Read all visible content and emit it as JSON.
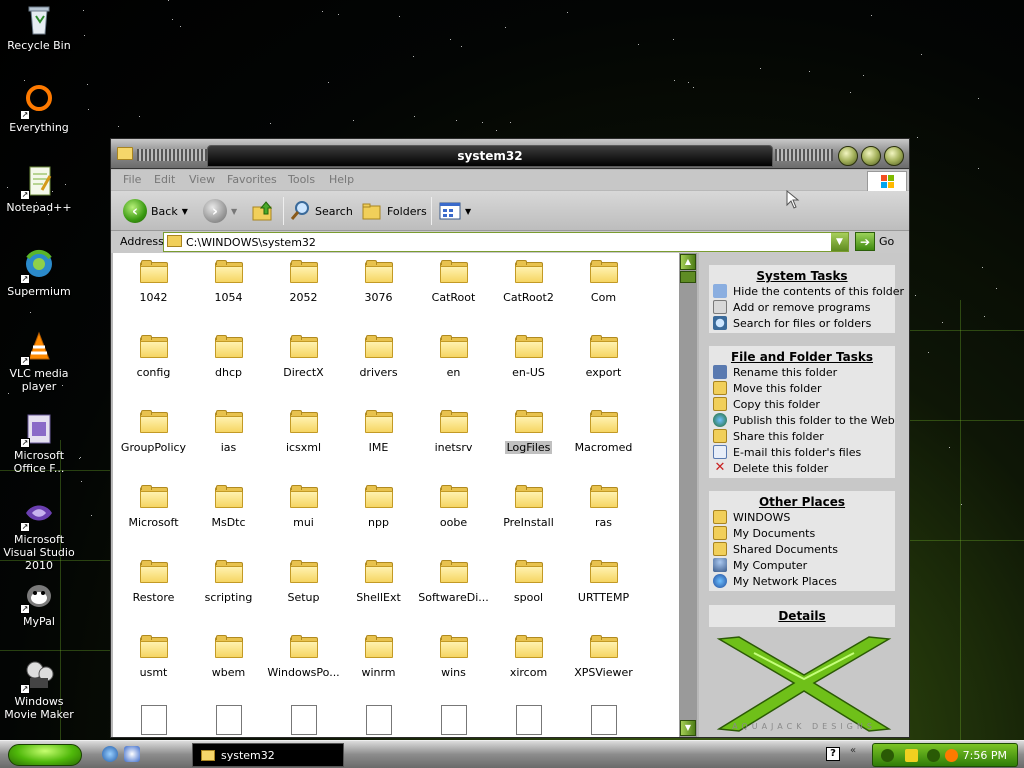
{
  "desktop": {
    "icons": [
      {
        "name": "recycle-bin",
        "label": "Recycle Bin"
      },
      {
        "name": "everything",
        "label": "Everything"
      },
      {
        "name": "notepadpp",
        "label": "Notepad++"
      },
      {
        "name": "supermium",
        "label": "Supermium"
      },
      {
        "name": "vlc",
        "label": "VLC media player"
      },
      {
        "name": "ms-office",
        "label": "Microsoft Office F..."
      },
      {
        "name": "ms-visual-studio",
        "label": "Microsoft Visual Studio 2010"
      },
      {
        "name": "mypal",
        "label": "MyPal"
      },
      {
        "name": "windows-movie-maker",
        "label": "Windows Movie Maker"
      }
    ]
  },
  "window": {
    "title": "system32",
    "menu": [
      "File",
      "Edit",
      "View",
      "Favorites",
      "Tools",
      "Help"
    ],
    "toolbar": {
      "back_label": "Back",
      "search_label": "Search",
      "folders_label": "Folders"
    },
    "address": {
      "label": "Address",
      "value": "C:\\WINDOWS\\system32",
      "go_label": "Go"
    },
    "items": [
      "1042",
      "1054",
      "2052",
      "3076",
      "CatRoot",
      "CatRoot2",
      "Com",
      "config",
      "dhcp",
      "DirectX",
      "drivers",
      "en",
      "en-US",
      "export",
      "GroupPolicy",
      "ias",
      "icsxml",
      "IME",
      "inetsrv",
      "LogFiles",
      "Macromed",
      "Microsoft",
      "MsDtc",
      "mui",
      "npp",
      "oobe",
      "PreInstall",
      "ras",
      "Restore",
      "scripting",
      "Setup",
      "ShellExt",
      "SoftwareDi...",
      "spool",
      "URTTEMP",
      "usmt",
      "wbem",
      "WindowsPo...",
      "winrm",
      "wins",
      "xircom",
      "XPSViewer"
    ],
    "selected_item": "LogFiles",
    "side_pane": {
      "system_tasks": {
        "title": "System Tasks",
        "items": [
          "Hide the contents of this folder",
          "Add or remove programs",
          "Search for files or folders"
        ]
      },
      "file_tasks": {
        "title": "File and Folder Tasks",
        "items": [
          "Rename this folder",
          "Move this folder",
          "Copy this folder",
          "Publish this folder to the Web",
          "Share this folder",
          "E-mail this folder's files",
          "Delete this folder"
        ]
      },
      "other_places": {
        "title": "Other Places",
        "items": [
          "WINDOWS",
          "My Documents",
          "Shared Documents",
          "My Computer",
          "My Network Places"
        ]
      },
      "details": {
        "title": "Details"
      },
      "brand_caption": "AQUAJACK DESIGNS"
    }
  },
  "taskbar": {
    "task_label": "system32",
    "clock": "7:56 PM",
    "help_glyph": "?"
  }
}
